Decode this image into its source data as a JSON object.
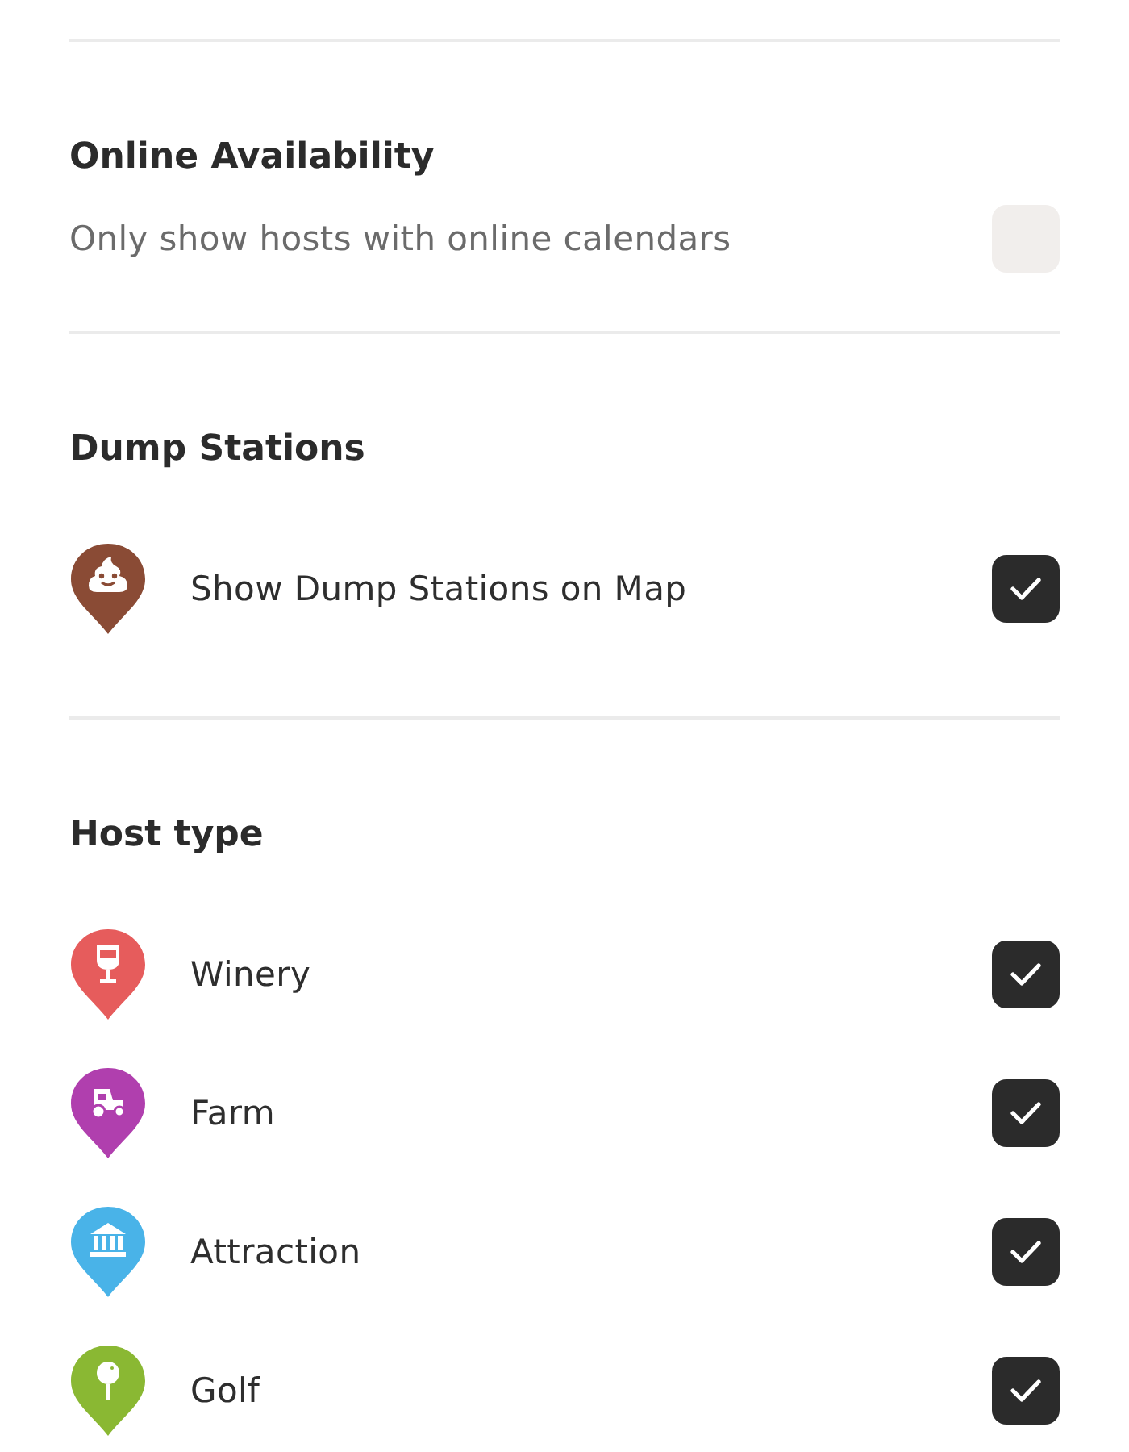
{
  "sections": [
    {
      "title": "Online Availability",
      "rows": [
        {
          "kind": "plain",
          "label": "Only show hosts with online calendars",
          "checked": false
        }
      ]
    },
    {
      "title": "Dump Stations",
      "rows": [
        {
          "kind": "dump",
          "label": "Show Dump Stations on Map",
          "checked": true,
          "color": "#8a4b35"
        }
      ]
    },
    {
      "title": "Host type",
      "rows": [
        {
          "kind": "winery",
          "label": "Winery",
          "checked": true,
          "color": "#e65c5c"
        },
        {
          "kind": "farm",
          "label": "Farm",
          "checked": true,
          "color": "#b03fae"
        },
        {
          "kind": "attraction",
          "label": "Attraction",
          "checked": true,
          "color": "#49b3e8"
        },
        {
          "kind": "golf",
          "label": "Golf",
          "checked": true,
          "color": "#8ab833"
        }
      ]
    }
  ]
}
